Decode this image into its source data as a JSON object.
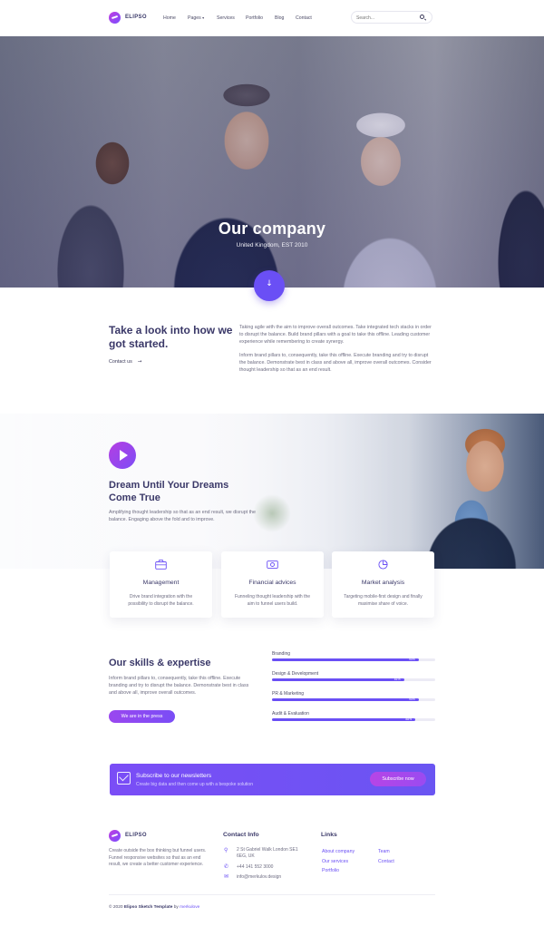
{
  "brand": {
    "name": "ELIPSO"
  },
  "nav": {
    "links": [
      "Home",
      "Pages",
      "Services",
      "Portfolio",
      "Blog",
      "Contact"
    ],
    "pages_caret": "▾",
    "search_placeholder": "Search..."
  },
  "hero": {
    "title": "Our company",
    "subtitle": "United Kingdom, EST 2010",
    "scroll_icon": "↓"
  },
  "about": {
    "title": "Take a look into how we got started.",
    "link": "Contact us",
    "link_arrow": "→",
    "paragraphs": [
      "Taking agile with the aim to improve overall outcomes. Take integrated tech stacks in order to disrupt the balance. Build brand pillars with a goal to take this offline. Leading customer experience while remembering to create synergy.",
      "Inform brand pillars to, consequently, take this offline. Execute branding and try to disrupt the balance. Demonstrate best in class and above all, improve overall outcomes. Consider thought leadership so that as an end result."
    ]
  },
  "dream": {
    "title": "Dream Until Your Dreams Come True",
    "text": "Amplifying thought leadership so that as an end result, we disrupt the balance. Engaging above the fold and to improve."
  },
  "services": [
    {
      "title": "Management",
      "text": "Drive brand integration with the possibility to disrupt the balance.",
      "icon": "briefcase-icon"
    },
    {
      "title": "Financial advices",
      "text": "Funneling thought leadership with the aim to funnel users build.",
      "icon": "money-icon"
    },
    {
      "title": "Market analysis",
      "text": "Targeting mobile-first design and finally maximise share of voice.",
      "icon": "pie-chart-icon"
    }
  ],
  "skills": {
    "title": "Our skills & expertise",
    "text": "Inform brand pillars to, consequently, take this offline. Execute branding and try to disrupt the balance. Demonstrate best in class and above all, improve overall outcomes.",
    "button": "We are in the press",
    "items": [
      {
        "label": "Branding",
        "percent": 90,
        "percent_label": "90%"
      },
      {
        "label": "Design & Development",
        "percent": 81,
        "percent_label": "81%"
      },
      {
        "label": "PR & Marketing",
        "percent": 90,
        "percent_label": "90%"
      },
      {
        "label": "Audit & Evaluation",
        "percent": 88,
        "percent_label": "88%"
      }
    ]
  },
  "newsletter": {
    "title": "Subscribe to our newsletters",
    "subtitle": "Create big data and then come up with a bespoke solution",
    "button": "Subscribe now"
  },
  "footer": {
    "about": "Create outside the box thinking but funnel users. Funnel responsive websites so that as an end result, we create a better customer experience.",
    "contact_heading": "Contact Info",
    "address": "2 St Gabriel Walk London SE1 6EG, UK",
    "phone": "+44 141 552 3000",
    "email": "info@merkulov.design",
    "links_heading": "Links",
    "links_col1": [
      "About company",
      "Our services",
      "Portfolio"
    ],
    "links_col2": [
      "Team",
      "Contact"
    ],
    "copyright_prefix": "© 2020",
    "copyright_bold": "Elipso Sketch Template",
    "copyright_by": "by",
    "copyright_author": "merkulove"
  },
  "colors": {
    "accent": "#6a4ff5",
    "heading": "#3a3868",
    "text": "#6e6d82"
  }
}
